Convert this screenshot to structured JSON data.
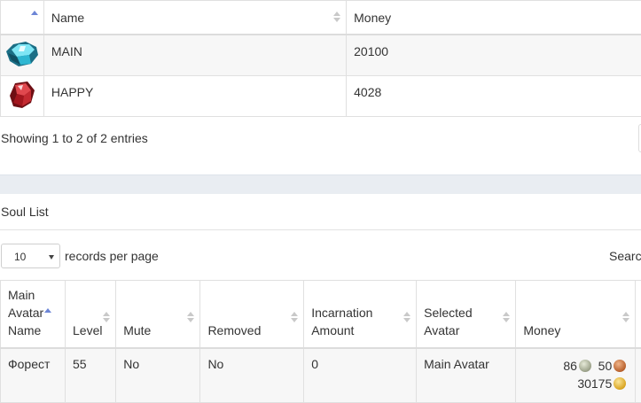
{
  "top_table": {
    "columns": {
      "name": "Name",
      "money": "Money"
    },
    "rows": [
      {
        "icon": "blue-crystal-icon",
        "name": "MAIN",
        "money": "20100"
      },
      {
        "icon": "red-crystal-icon",
        "name": "HAPPY",
        "money": "4028"
      }
    ],
    "info": "Showing 1 to 2 of 2 entries"
  },
  "soul_list": {
    "title": "Soul List",
    "page_size": "10",
    "per_page_label": "records per page",
    "search_label": "Searc",
    "columns": {
      "main_avatar_name_1": "Main",
      "main_avatar_name_2": "Avatar",
      "main_avatar_name_3": "Name",
      "level": "Level",
      "mute": "Mute",
      "removed": "Removed",
      "incarnation_1": "Incarnation",
      "incarnation_2": "Amount",
      "selected_avatar_1": "Selected",
      "selected_avatar_2": "Avatar",
      "money": "Money"
    },
    "rows": [
      {
        "name": "Форест",
        "level": "55",
        "mute": "No",
        "removed": "No",
        "incarnation": "0",
        "selected_avatar": "Main Avatar",
        "money_silver": "86",
        "money_copper": "50",
        "money_gold": "30175"
      }
    ]
  }
}
